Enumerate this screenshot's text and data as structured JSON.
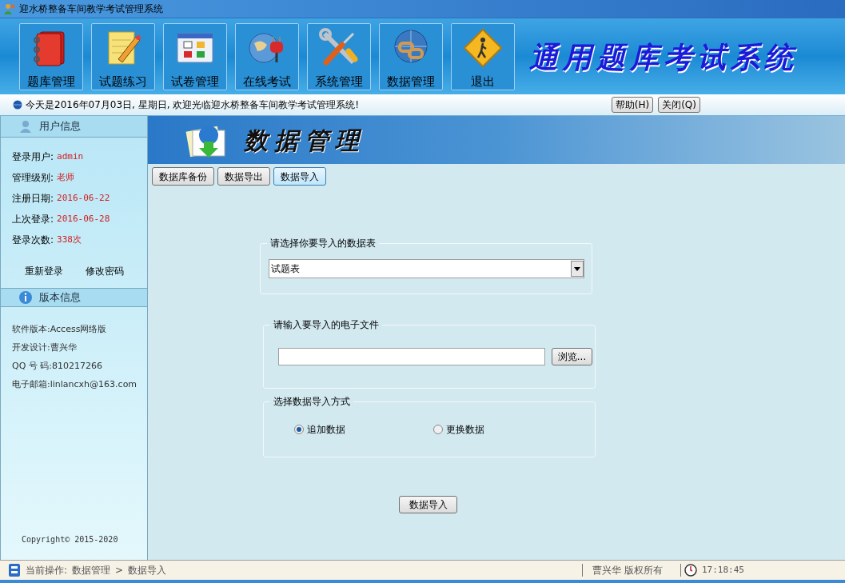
{
  "window": {
    "title": "迎水桥整备车间教学考试管理系统"
  },
  "toolbar": {
    "items": [
      {
        "label": "题库管理"
      },
      {
        "label": "试题练习"
      },
      {
        "label": "试卷管理"
      },
      {
        "label": "在线考试"
      },
      {
        "label": "系统管理"
      },
      {
        "label": "数据管理"
      },
      {
        "label": "退出"
      }
    ],
    "banner": "通用题库考试系统"
  },
  "info_bar": {
    "welcome": "今天是2016年07月03日, 星期日, 欢迎光临迎水桥整备车间教学考试管理系统!",
    "buttons": [
      "帮助(H)",
      "关闭(Q)"
    ]
  },
  "sidebar": {
    "user_info": {
      "title": "用户信息",
      "fields": [
        {
          "label": "登录用户:",
          "value": "admin"
        },
        {
          "label": "管理级别:",
          "value": "老师"
        },
        {
          "label": "注册日期:",
          "value": "2016-06-22"
        },
        {
          "label": "上次登录:",
          "value": "2016-06-28"
        },
        {
          "label": "登录次数:",
          "value": "338次"
        }
      ],
      "links": [
        "重新登录",
        "修改密码"
      ]
    },
    "version_info": {
      "title": "版本信息",
      "lines": [
        "软件版本:Access网络版",
        "开发设计:曹兴华",
        "QQ 号 码:810217266",
        "电子邮箱:linlancxh@163.com"
      ]
    },
    "copyright": "Copyright© 2015-2020"
  },
  "page_header": {
    "title": "数据管理"
  },
  "tabs": [
    {
      "label": "数据库备份",
      "selected": false
    },
    {
      "label": "数据导出",
      "selected": false
    },
    {
      "label": "数据导入",
      "selected": true
    }
  ],
  "table_select": {
    "legend": "请选择你要导入的数据表",
    "value": "试题表"
  },
  "file_input": {
    "legend": "请输入要导入的电子文件",
    "button": "浏览..."
  },
  "import_mode": {
    "legend": "选择数据导入方式",
    "options": [
      {
        "label": "追加数据",
        "selected": true
      },
      {
        "label": "更换数据",
        "selected": false
      }
    ]
  },
  "submit": "数据导入",
  "status_bar": {
    "label": "当前操作:",
    "path": [
      "数据管理",
      ">",
      "数据导入"
    ],
    "owner": "曹兴华 版权所有",
    "time": "17:18:45"
  }
}
